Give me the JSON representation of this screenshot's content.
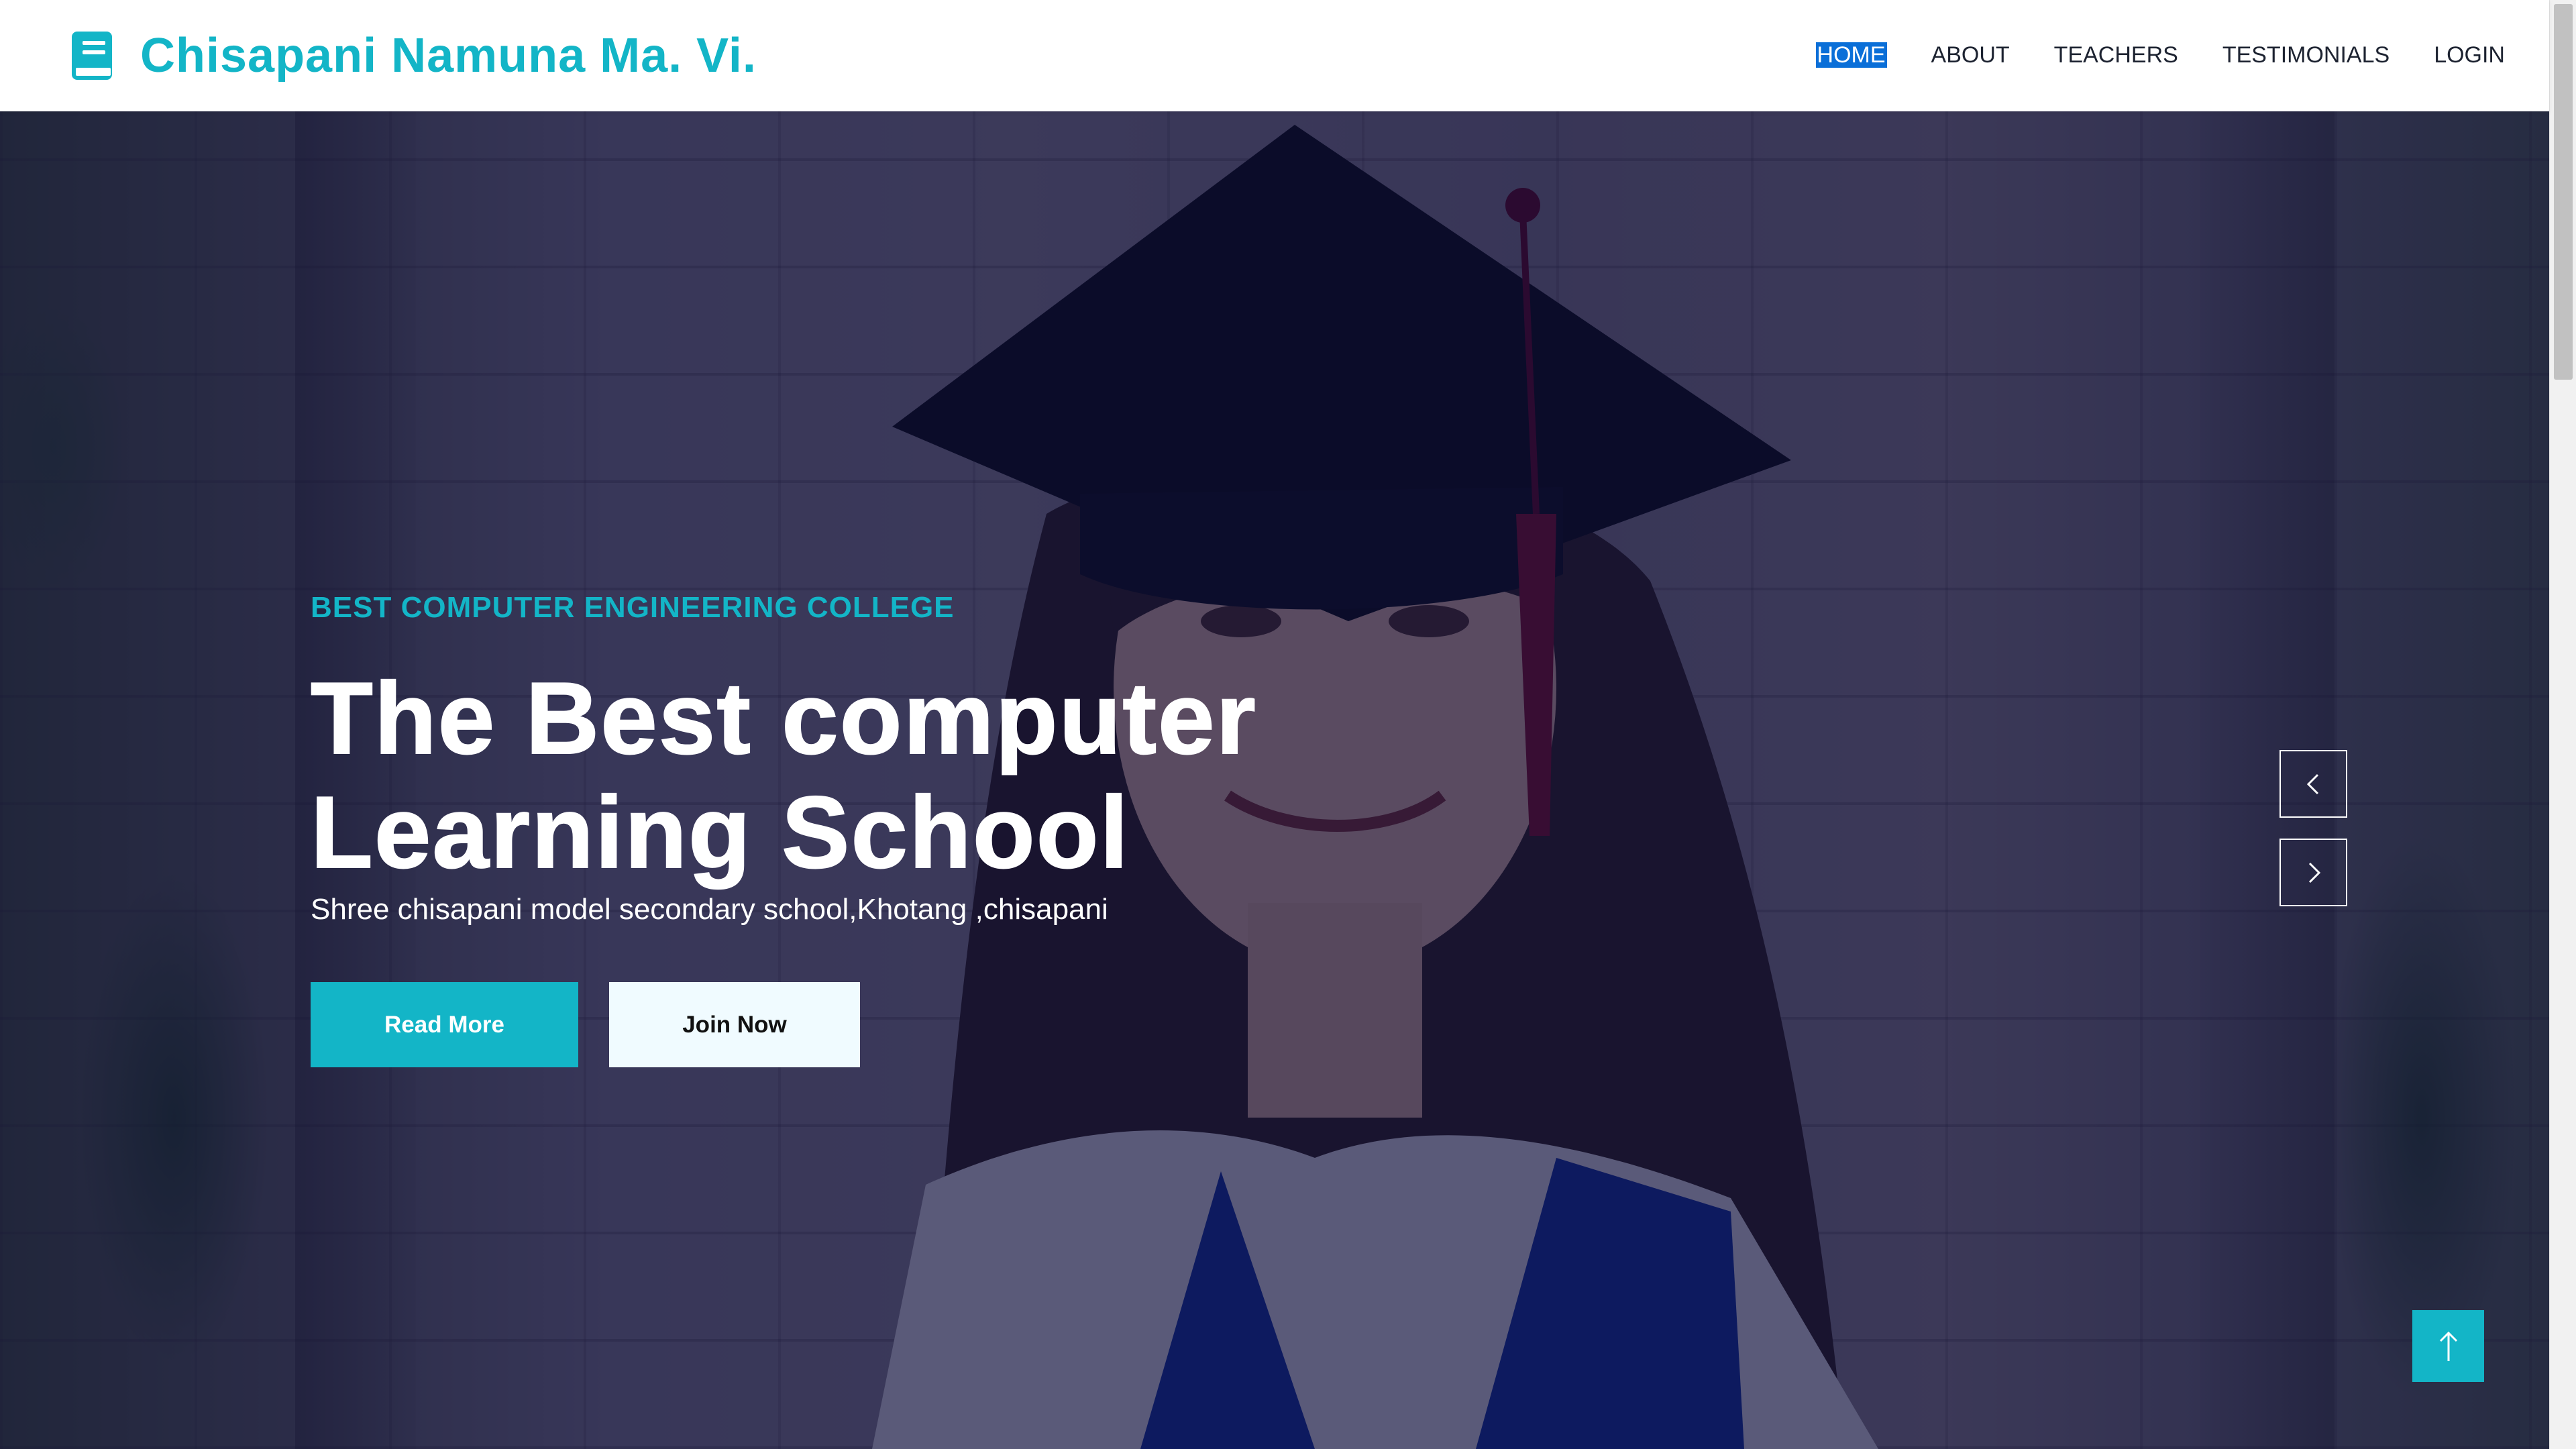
{
  "brand": {
    "name": "Chisapani Namuna Ma. Vi.",
    "icon": "book-icon",
    "color": "#13b5c7"
  },
  "nav": {
    "items": [
      {
        "label": "HOME",
        "active": true
      },
      {
        "label": "ABOUT",
        "active": false
      },
      {
        "label": "TEACHERS",
        "active": false
      },
      {
        "label": "TESTIMONIALS",
        "active": false
      },
      {
        "label": "LOGIN",
        "active": false
      }
    ]
  },
  "hero": {
    "eyebrow": "BEST COMPUTER ENGINEERING COLLEGE",
    "title_line1": "The Best computer",
    "title_line2": "Learning School",
    "subtitle": "Shree chisapani model secondary school,Khotang ,chisapani",
    "primary_button": "Read More",
    "secondary_button": "Join Now",
    "background": "graduate-photo",
    "overlay_color": "#06083e"
  },
  "carousel": {
    "prev_icon": "chevron-left-icon",
    "next_icon": "chevron-right-icon"
  },
  "back_to_top": {
    "icon": "arrow-up-icon"
  },
  "colors": {
    "accent": "#13b5c7",
    "active_nav_bg": "#0a6fd8",
    "nav_text": "#1d2331"
  }
}
